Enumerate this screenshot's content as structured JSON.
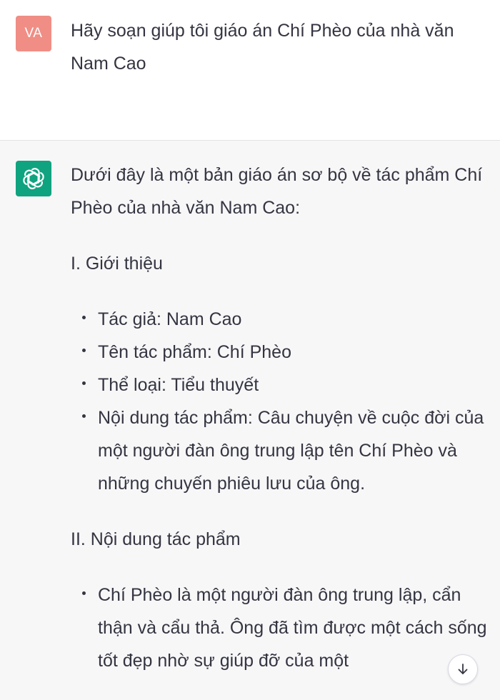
{
  "user_message": {
    "avatar_initials": "VA",
    "text": "Hãy soạn giúp tôi giáo án Chí Phèo của nhà văn Nam Cao"
  },
  "assistant_message": {
    "avatar_icon": "openai-logo-icon",
    "intro": "Dưới đây là một bản giáo án sơ bộ về tác phẩm Chí Phèo của nhà văn Nam Cao:",
    "sections": [
      {
        "heading": "I. Giới thiệu",
        "items": [
          "Tác giả: Nam Cao",
          "Tên tác phẩm: Chí Phèo",
          "Thể loại: Tiểu thuyết",
          "Nội dung tác phẩm: Câu chuyện về cuộc đời của một người đàn ông trung lập tên Chí Phèo và những chuyến phiêu lưu của ông."
        ]
      },
      {
        "heading": "II. Nội dung tác phẩm",
        "items": [
          "Chí Phèo là một người đàn ông trung lập, cẩn thận và cẩu thả. Ông đã tìm được một cách sống tốt đẹp nhờ sự giúp đỡ của một"
        ]
      }
    ]
  },
  "scroll_button": {
    "icon": "arrow-down-icon"
  },
  "colors": {
    "user_avatar": "#f08e85",
    "bot_avatar": "#10a37f",
    "assistant_bg": "#f7f7f8",
    "user_bg": "#ffffff",
    "text": "#343541"
  }
}
